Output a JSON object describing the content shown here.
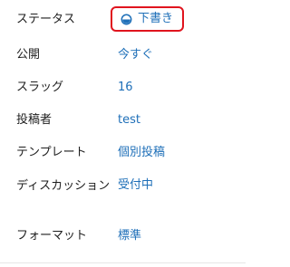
{
  "status": {
    "label": "ステータス",
    "value": "下書き",
    "icon": "draft-status-icon",
    "highlight_color": "#e0141e"
  },
  "fields": {
    "visibility": {
      "label": "公開",
      "value": "今すぐ"
    },
    "slug": {
      "label": "スラッグ",
      "value": "16"
    },
    "author": {
      "label": "投稿者",
      "value": "test"
    },
    "template": {
      "label": "テンプレート",
      "value": "個別投稿"
    },
    "discussion": {
      "label": "ディスカッション",
      "value": "受付中"
    },
    "format": {
      "label": "フォーマット",
      "value": "標準"
    }
  },
  "colors": {
    "link": "#1e6fb8",
    "label": "#1e1e1e"
  }
}
